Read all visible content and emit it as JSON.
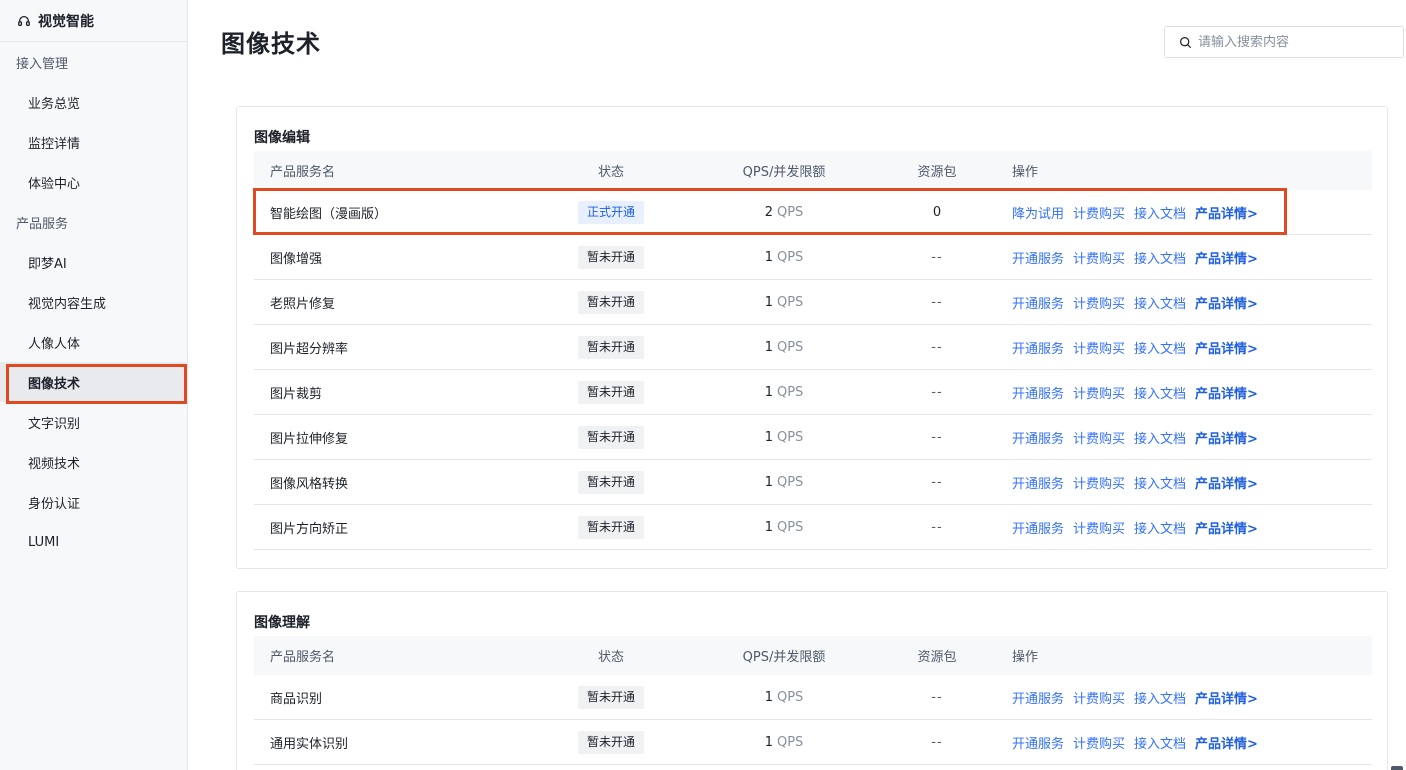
{
  "brand": {
    "title": "视觉智能",
    "icon": "headset-icon"
  },
  "sidebar": {
    "groups": [
      {
        "label": "接入管理",
        "items": [
          "业务总览",
          "监控详情",
          "体验中心"
        ]
      },
      {
        "label": "产品服务",
        "items": [
          "即梦AI",
          "视觉内容生成",
          "人像人体",
          "图像技术",
          "文字识别",
          "视频技术",
          "身份认证",
          "LUMI"
        ]
      }
    ],
    "active": "图像技术"
  },
  "header": {
    "title": "图像技术",
    "search_placeholder": "请输入搜索内容"
  },
  "columns": {
    "name": "产品服务名",
    "status": "状态",
    "qps": "QPS/并发限额",
    "package": "资源包",
    "ops": "操作"
  },
  "sections": [
    {
      "title": "图像编辑",
      "rows": [
        {
          "name": "智能绘图（漫画版）",
          "status": "正式开通",
          "status_type": "on",
          "qps": "2",
          "qps_unit": "QPS",
          "package": "0",
          "ops": [
            "降为试用",
            "计费购买",
            "接入文档",
            "产品详情>"
          ]
        },
        {
          "name": "图像增强",
          "status": "暂未开通",
          "status_type": "off",
          "qps": "1",
          "qps_unit": "QPS",
          "package": "--",
          "ops": [
            "开通服务",
            "计费购买",
            "接入文档",
            "产品详情>"
          ]
        },
        {
          "name": "老照片修复",
          "status": "暂未开通",
          "status_type": "off",
          "qps": "1",
          "qps_unit": "QPS",
          "package": "--",
          "ops": [
            "开通服务",
            "计费购买",
            "接入文档",
            "产品详情>"
          ]
        },
        {
          "name": "图片超分辨率",
          "status": "暂未开通",
          "status_type": "off",
          "qps": "1",
          "qps_unit": "QPS",
          "package": "--",
          "ops": [
            "开通服务",
            "计费购买",
            "接入文档",
            "产品详情>"
          ]
        },
        {
          "name": "图片裁剪",
          "status": "暂未开通",
          "status_type": "off",
          "qps": "1",
          "qps_unit": "QPS",
          "package": "--",
          "ops": [
            "开通服务",
            "计费购买",
            "接入文档",
            "产品详情>"
          ]
        },
        {
          "name": "图片拉伸修复",
          "status": "暂未开通",
          "status_type": "off",
          "qps": "1",
          "qps_unit": "QPS",
          "package": "--",
          "ops": [
            "开通服务",
            "计费购买",
            "接入文档",
            "产品详情>"
          ]
        },
        {
          "name": "图像风格转换",
          "status": "暂未开通",
          "status_type": "off",
          "qps": "1",
          "qps_unit": "QPS",
          "package": "--",
          "ops": [
            "开通服务",
            "计费购买",
            "接入文档",
            "产品详情>"
          ]
        },
        {
          "name": "图片方向矫正",
          "status": "暂未开通",
          "status_type": "off",
          "qps": "1",
          "qps_unit": "QPS",
          "package": "--",
          "ops": [
            "开通服务",
            "计费购买",
            "接入文档",
            "产品详情>"
          ]
        }
      ]
    },
    {
      "title": "图像理解",
      "rows": [
        {
          "name": "商品识别",
          "status": "暂未开通",
          "status_type": "off",
          "qps": "1",
          "qps_unit": "QPS",
          "package": "--",
          "ops": [
            "开通服务",
            "计费购买",
            "接入文档",
            "产品详情>"
          ]
        },
        {
          "name": "通用实体识别",
          "status": "暂未开通",
          "status_type": "off",
          "qps": "1",
          "qps_unit": "QPS",
          "package": "--",
          "ops": [
            "开通服务",
            "计费购买",
            "接入文档",
            "产品详情>"
          ]
        }
      ]
    }
  ],
  "colors": {
    "accent": "#3370ff",
    "highlight": "#e04a22"
  }
}
